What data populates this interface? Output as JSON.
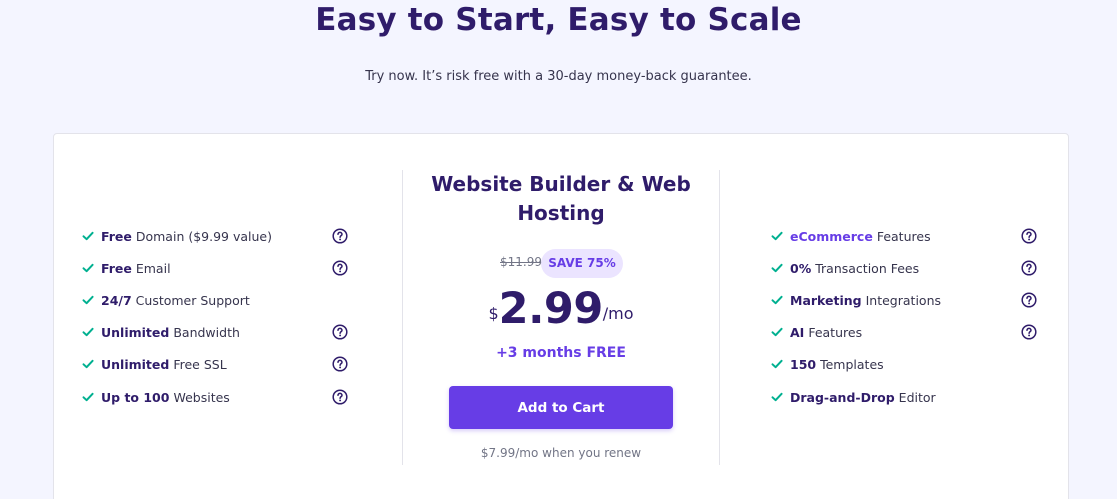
{
  "header": {
    "title": "Easy to Start, Easy to Scale",
    "subtitle": "Try now. It’s risk free with a 30-day money-back guarantee."
  },
  "colors": {
    "accent": "#673de6",
    "check": "#00b090",
    "heading": "#2f1c6a"
  },
  "plan": {
    "title": "Website Builder & Web Hosting",
    "old_price": "$11.99",
    "save_badge": "SAVE 75%",
    "currency": "$",
    "price": "2.99",
    "period": "/mo",
    "bonus": "+3 months FREE",
    "cta": "Add to Cart",
    "renew_note": "$7.99/mo when you renew"
  },
  "left_features": [
    {
      "bold": "Free",
      "text": "Domain ($9.99 value)",
      "help": true,
      "icon": "check-icon"
    },
    {
      "bold": "Free",
      "text": "Email",
      "help": true,
      "icon": "check-icon"
    },
    {
      "bold": "24/7",
      "text": "Customer Support",
      "help": false,
      "icon": "check-icon"
    },
    {
      "bold": "Unlimited",
      "text": "Bandwidth",
      "help": true,
      "icon": "check-icon"
    },
    {
      "bold": "Unlimited",
      "text": "Free SSL",
      "help": true,
      "icon": "check-icon"
    },
    {
      "bold": "Up to 100",
      "text": "Websites",
      "help": true,
      "icon": "check-icon"
    }
  ],
  "right_features": [
    {
      "bold": "eCommerce",
      "text": "Features",
      "help": true,
      "accent": true,
      "icon": "check-icon"
    },
    {
      "bold": "0%",
      "text": "Transaction Fees",
      "help": true,
      "icon": "check-icon"
    },
    {
      "bold": "Marketing",
      "text": "Integrations",
      "help": true,
      "icon": "check-icon"
    },
    {
      "bold": "AI",
      "text": "Features",
      "help": true,
      "icon": "check-icon"
    },
    {
      "bold": "150",
      "text": "Templates",
      "help": false,
      "icon": "check-icon"
    },
    {
      "bold": "Drag-and-Drop",
      "text": "Editor",
      "help": false,
      "icon": "check-icon"
    }
  ]
}
